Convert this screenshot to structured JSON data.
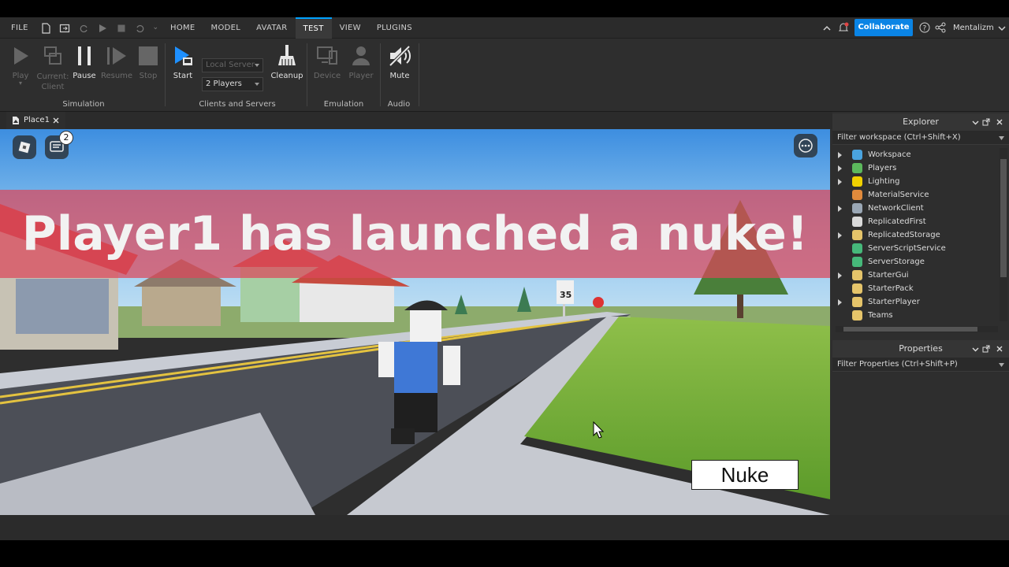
{
  "menubar": {
    "file": "FILE",
    "tabs": [
      "HOME",
      "MODEL",
      "AVATAR",
      "TEST",
      "VIEW",
      "PLUGINS"
    ],
    "collaborate": "Collaborate",
    "username": "Mentalizm"
  },
  "ribbon": {
    "play": "Play",
    "current_client": "Current:\nClient",
    "pause": "Pause",
    "resume": "Resume",
    "stop": "Stop",
    "simulation_label": "Simulation",
    "start": "Start",
    "server_select": "Local Server",
    "players_select": "2 Players",
    "cleanup": "Cleanup",
    "clients_servers_label": "Clients and Servers",
    "device": "Device",
    "player": "Player",
    "emulation_label": "Emulation",
    "mute": "Mute",
    "audio_label": "Audio"
  },
  "document_tab": {
    "label": "Place1"
  },
  "viewport": {
    "chat_badge_count": "2",
    "banner_text": "Player1 has launched a nuke!",
    "sign_text": "35",
    "nuke_button": "Nuke"
  },
  "explorer": {
    "title": "Explorer",
    "filter_placeholder": "Filter workspace (Ctrl+Shift+X)",
    "items": [
      {
        "label": "Workspace",
        "icon": "workspace-icon",
        "color": "#4aa3df",
        "expandable": true
      },
      {
        "label": "Players",
        "icon": "players-icon",
        "color": "#5cb85c",
        "expandable": true
      },
      {
        "label": "Lighting",
        "icon": "lighting-icon",
        "color": "#f0d000",
        "expandable": true
      },
      {
        "label": "MaterialService",
        "icon": "material-service-icon",
        "color": "#e08a3c",
        "expandable": false
      },
      {
        "label": "NetworkClient",
        "icon": "network-client-icon",
        "color": "#9aa7b5",
        "expandable": true
      },
      {
        "label": "ReplicatedFirst",
        "icon": "replicated-first-icon",
        "color": "#d9d9d9",
        "expandable": false
      },
      {
        "label": "ReplicatedStorage",
        "icon": "replicated-storage-icon",
        "color": "#e5c46a",
        "expandable": true
      },
      {
        "label": "ServerScriptService",
        "icon": "server-script-service-icon",
        "color": "#46b87a",
        "expandable": false
      },
      {
        "label": "ServerStorage",
        "icon": "server-storage-icon",
        "color": "#46b87a",
        "expandable": false
      },
      {
        "label": "StarterGui",
        "icon": "starter-gui-icon",
        "color": "#e5c46a",
        "expandable": true
      },
      {
        "label": "StarterPack",
        "icon": "starter-pack-icon",
        "color": "#e5c46a",
        "expandable": false
      },
      {
        "label": "StarterPlayer",
        "icon": "starter-player-icon",
        "color": "#e5c46a",
        "expandable": true
      },
      {
        "label": "Teams",
        "icon": "teams-icon",
        "color": "#e5c46a",
        "expandable": false
      }
    ]
  },
  "properties": {
    "title": "Properties",
    "filter_placeholder": "Filter Properties (Ctrl+Shift+P)"
  },
  "colors": {
    "accent": "#00a2ff",
    "collaborate": "#0a84e5",
    "banner": "#dc465a"
  }
}
